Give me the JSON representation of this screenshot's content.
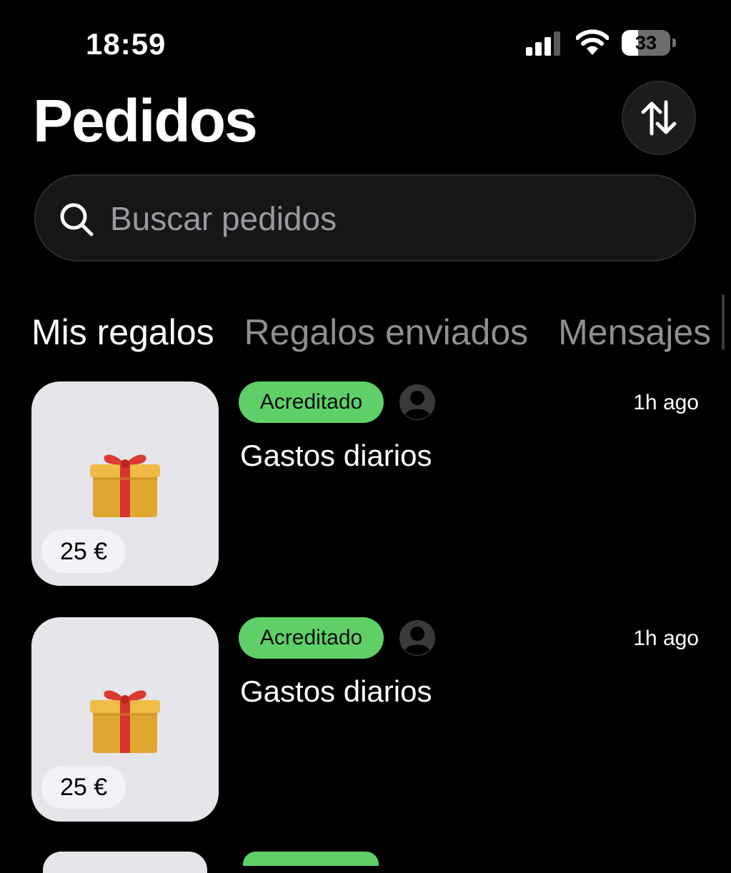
{
  "status_bar": {
    "time": "18:59",
    "battery": "33"
  },
  "header": {
    "title": "Pedidos",
    "sort_icon": "sort-arrows-icon"
  },
  "search": {
    "placeholder": "Buscar pedidos",
    "icon": "search-icon"
  },
  "tabs": [
    {
      "label": "Mis regalos",
      "active": true
    },
    {
      "label": "Regalos enviados",
      "active": false
    },
    {
      "label": "Mensajes",
      "active": false
    }
  ],
  "orders": [
    {
      "price": "25 €",
      "status": "Acreditado",
      "time": "1h ago",
      "title": "Gastos diarios"
    },
    {
      "price": "25 €",
      "status": "Acreditado",
      "time": "1h ago",
      "title": "Gastos diarios"
    }
  ],
  "colors": {
    "background": "#000000",
    "badge_green": "#5fd068",
    "tile_bg": "#e5e5ea",
    "muted_text": "#8e8e93",
    "search_bg": "#161618"
  }
}
